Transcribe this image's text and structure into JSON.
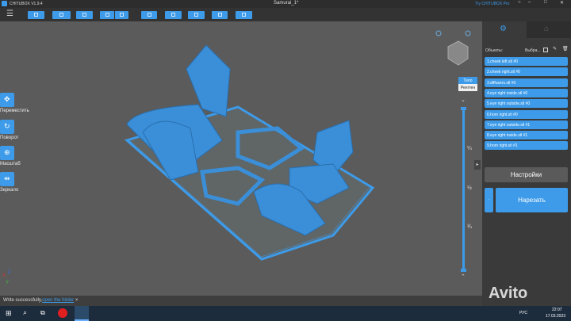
{
  "title_bar": {
    "app_name": "CHITUBOX V1.9.4",
    "document": "Samurai_1*",
    "promo": "Try CHITUBOX Pro"
  },
  "left_tools": [
    {
      "label": "Переместить",
      "icon": "move-icon"
    },
    {
      "label": "Поворот",
      "icon": "rotate-icon"
    },
    {
      "label": "Масштаб",
      "icon": "scale-icon"
    },
    {
      "label": "Зеркало",
      "icon": "mirror-icon"
    }
  ],
  "view": {
    "body_label": "Тело",
    "xray_label": "Рентген",
    "slider_marks": [
      "¼",
      "½",
      "¾"
    ],
    "axes": {
      "x": "X",
      "y": "Y",
      "z": "Z"
    }
  },
  "panel": {
    "objects_label": "Объекты:",
    "select_label": "Выбра...",
    "objects": [
      "1.cheek left.stl #0",
      "2.cheek right.stl #0",
      "3.diffusers.stl #0",
      "4.eye right inside.stl #0",
      "5.eye right outside.stl #0",
      "6.horn right.stl #0",
      "7.eye right outside.stl #1",
      "8.eye right inside.stl #1",
      "9.horn right.stl #1"
    ],
    "settings_label": "Настройки",
    "slice_label": "Нарезать"
  },
  "status": {
    "message": "Write successfully,",
    "link": "open the folder",
    "close": "×"
  },
  "taskbar": {
    "lang": "РУС",
    "time": "22:07",
    "date": "17.03.2023"
  },
  "watermark": "Avito",
  "colors": {
    "accent": "#3d9be9",
    "background": "#5b5b5b",
    "panel": "#3a3a3a"
  }
}
